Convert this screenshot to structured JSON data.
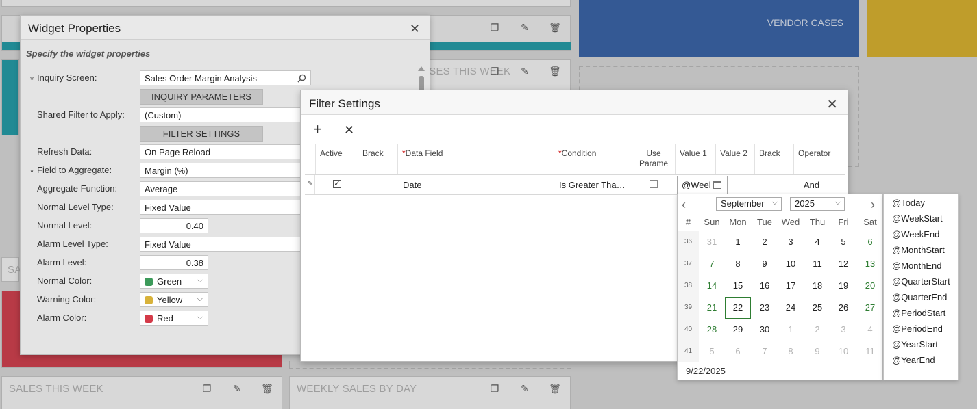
{
  "background": {
    "vendor_cases": "VENDOR CASES",
    "cases_this_week": "CASES THIS WEEK",
    "sales_this_week": "SALES THIS WEEK",
    "weekly_sales_by_day": "WEEKLY SALES BY DAY",
    "sales_cutoff": "SA",
    "colors": {
      "blue": "#3360a8",
      "yellow": "#dcb228",
      "teal": "#1c9ca8",
      "red": "#d43a48"
    }
  },
  "widget_properties": {
    "title": "Widget Properties",
    "subtitle": "Specify the widget properties",
    "fields": {
      "inquiry_screen": {
        "label": "Inquiry Screen:",
        "value": "Sales Order Margin Analysis",
        "required": true
      },
      "inquiry_parameters_btn": "INQUIRY PARAMETERS",
      "shared_filter": {
        "label": "Shared Filter to Apply:",
        "value": "(Custom)"
      },
      "filter_settings_btn": "FILTER SETTINGS",
      "refresh_data": {
        "label": "Refresh Data:",
        "value": "On Page Reload"
      },
      "field_to_aggregate": {
        "label": "Field to Aggregate:",
        "value": "Margin (%)",
        "required": true
      },
      "aggregate_function": {
        "label": "Aggregate Function:",
        "value": "Average"
      },
      "normal_level_type": {
        "label": "Normal Level Type:",
        "value": "Fixed Value"
      },
      "normal_level": {
        "label": "Normal Level:",
        "value": "0.40"
      },
      "alarm_level_type": {
        "label": "Alarm Level Type:",
        "value": "Fixed Value"
      },
      "alarm_level": {
        "label": "Alarm Level:",
        "value": "0.38"
      },
      "normal_color": {
        "label": "Normal Color:",
        "value": "Green",
        "swatch": "#3c9a5a"
      },
      "warning_color": {
        "label": "Warning Color:",
        "value": "Yellow",
        "swatch": "#d8b23a"
      },
      "alarm_color": {
        "label": "Alarm Color:",
        "value": "Red",
        "swatch": "#d43a48"
      }
    }
  },
  "filter_settings": {
    "title": "Filter Settings",
    "columns": {
      "active": "Active",
      "brack_open": "Brack",
      "data_field": "Data Field",
      "condition": "Condition",
      "use_param": "Use Parame",
      "value1": "Value 1",
      "value2": "Value 2",
      "brack_close": "Brack",
      "operator": "Operator"
    },
    "row": {
      "active": "✓",
      "data_field": "Date",
      "condition": "Is Greater Tha…",
      "value1": "@Weel",
      "operator": "And"
    }
  },
  "calendar": {
    "month": "September",
    "year": "2025",
    "week_header": "#",
    "days_of_week": [
      "Sun",
      "Mon",
      "Tue",
      "Wed",
      "Thu",
      "Fri",
      "Sat"
    ],
    "weeks": [
      {
        "num": "36",
        "days": [
          "31",
          "1",
          "2",
          "3",
          "4",
          "5",
          "6"
        ]
      },
      {
        "num": "37",
        "days": [
          "7",
          "8",
          "9",
          "10",
          "11",
          "12",
          "13"
        ]
      },
      {
        "num": "38",
        "days": [
          "14",
          "15",
          "16",
          "17",
          "18",
          "19",
          "20"
        ]
      },
      {
        "num": "39",
        "days": [
          "21",
          "22",
          "23",
          "24",
          "25",
          "26",
          "27"
        ]
      },
      {
        "num": "40",
        "days": [
          "28",
          "29",
          "30",
          "1",
          "2",
          "3",
          "4"
        ]
      },
      {
        "num": "41",
        "days": [
          "5",
          "6",
          "7",
          "8",
          "9",
          "10",
          "11"
        ]
      }
    ],
    "selected_day": "22",
    "footer_date": "9/22/2025"
  },
  "variables": [
    "@Today",
    "@WeekStart",
    "@WeekEnd",
    "@MonthStart",
    "@MonthEnd",
    "@QuarterStart",
    "@QuarterEnd",
    "@PeriodStart",
    "@PeriodEnd",
    "@YearStart",
    "@YearEnd"
  ]
}
